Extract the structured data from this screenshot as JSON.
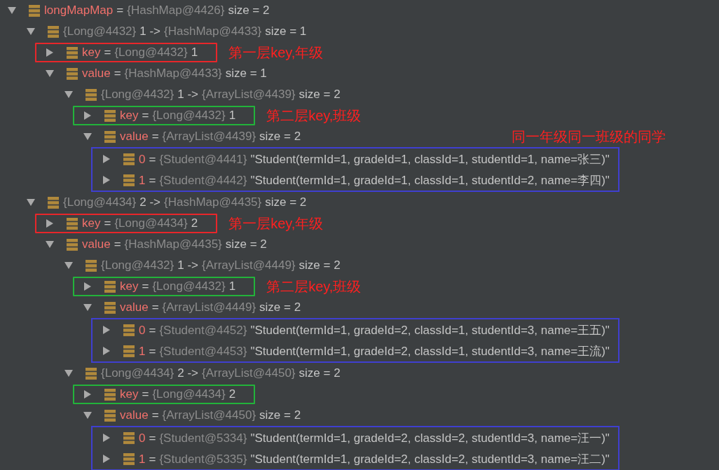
{
  "tree": {
    "expanded": true,
    "segments": [
      {
        "kind": "name",
        "text": "longMapMap"
      },
      {
        "kind": "plain",
        "text": "="
      },
      {
        "kind": "ref",
        "text": "{HashMap@4426}"
      },
      {
        "kind": "plain",
        "text": "size = 2"
      }
    ],
    "children": [
      {
        "expanded": true,
        "segments": [
          {
            "kind": "ref",
            "text": "{Long@4432}"
          },
          {
            "kind": "plain",
            "text": "1 ->"
          },
          {
            "kind": "ref",
            "text": "{HashMap@4433}"
          },
          {
            "kind": "plain",
            "text": "size = 1"
          }
        ],
        "children": [
          {
            "expanded": false,
            "frame": {
              "color": "#e8262a",
              "note": "第一层key,年级"
            },
            "segments": [
              {
                "kind": "name",
                "text": "key"
              },
              {
                "kind": "plain",
                "text": "="
              },
              {
                "kind": "ref",
                "text": "{Long@4432}"
              },
              {
                "kind": "plain",
                "text": "1"
              }
            ]
          },
          {
            "expanded": true,
            "segments": [
              {
                "kind": "name",
                "text": "value"
              },
              {
                "kind": "plain",
                "text": "="
              },
              {
                "kind": "ref",
                "text": "{HashMap@4433}"
              },
              {
                "kind": "plain",
                "text": "size = 1"
              }
            ],
            "children": [
              {
                "expanded": true,
                "segments": [
                  {
                    "kind": "ref",
                    "text": "{Long@4432}"
                  },
                  {
                    "kind": "plain",
                    "text": "1 ->"
                  },
                  {
                    "kind": "ref",
                    "text": "{ArrayList@4439}"
                  },
                  {
                    "kind": "plain",
                    "text": "size = 2"
                  }
                ],
                "children": [
                  {
                    "expanded": false,
                    "frame": {
                      "color": "#22b33a",
                      "note": "第二层key,班级"
                    },
                    "segments": [
                      {
                        "kind": "name",
                        "text": "key"
                      },
                      {
                        "kind": "plain",
                        "text": "="
                      },
                      {
                        "kind": "ref",
                        "text": "{Long@4432}"
                      },
                      {
                        "kind": "plain",
                        "text": "1"
                      }
                    ]
                  },
                  {
                    "expanded": true,
                    "children_frame": {
                      "color": "#3f3fd0",
                      "note": "同一年级同一班级的同学"
                    },
                    "segments": [
                      {
                        "kind": "name",
                        "text": "value"
                      },
                      {
                        "kind": "plain",
                        "text": "="
                      },
                      {
                        "kind": "ref",
                        "text": "{ArrayList@4439}"
                      },
                      {
                        "kind": "plain",
                        "text": "size = 2"
                      }
                    ],
                    "children": [
                      {
                        "expanded": false,
                        "segments": [
                          {
                            "kind": "name",
                            "text": "0"
                          },
                          {
                            "kind": "plain",
                            "text": "="
                          },
                          {
                            "kind": "ref",
                            "text": "{Student@4441}"
                          },
                          {
                            "kind": "plain",
                            "text": "\"Student(termId=1, gradeId=1, classId=1, studentId=1, name=张三)\""
                          }
                        ]
                      },
                      {
                        "expanded": false,
                        "segments": [
                          {
                            "kind": "name",
                            "text": "1"
                          },
                          {
                            "kind": "plain",
                            "text": "="
                          },
                          {
                            "kind": "ref",
                            "text": "{Student@4442}"
                          },
                          {
                            "kind": "plain",
                            "text": "\"Student(termId=1, gradeId=1, classId=1, studentId=2, name=李四)\""
                          }
                        ]
                      }
                    ]
                  }
                ]
              }
            ]
          }
        ]
      },
      {
        "expanded": true,
        "segments": [
          {
            "kind": "ref",
            "text": "{Long@4434}"
          },
          {
            "kind": "plain",
            "text": "2 ->"
          },
          {
            "kind": "ref",
            "text": "{HashMap@4435}"
          },
          {
            "kind": "plain",
            "text": "size = 2"
          }
        ],
        "children": [
          {
            "expanded": false,
            "frame": {
              "color": "#e8262a",
              "note": "第一层key,年级"
            },
            "segments": [
              {
                "kind": "name",
                "text": "key"
              },
              {
                "kind": "plain",
                "text": "="
              },
              {
                "kind": "ref",
                "text": "{Long@4434}"
              },
              {
                "kind": "plain",
                "text": "2"
              }
            ]
          },
          {
            "expanded": true,
            "segments": [
              {
                "kind": "name",
                "text": "value"
              },
              {
                "kind": "plain",
                "text": "="
              },
              {
                "kind": "ref",
                "text": "{HashMap@4435}"
              },
              {
                "kind": "plain",
                "text": "size = 2"
              }
            ],
            "children": [
              {
                "expanded": true,
                "segments": [
                  {
                    "kind": "ref",
                    "text": "{Long@4432}"
                  },
                  {
                    "kind": "plain",
                    "text": "1 ->"
                  },
                  {
                    "kind": "ref",
                    "text": "{ArrayList@4449}"
                  },
                  {
                    "kind": "plain",
                    "text": "size = 2"
                  }
                ],
                "children": [
                  {
                    "expanded": false,
                    "frame": {
                      "color": "#22b33a",
                      "note": "第二层key,班级"
                    },
                    "segments": [
                      {
                        "kind": "name",
                        "text": "key"
                      },
                      {
                        "kind": "plain",
                        "text": "="
                      },
                      {
                        "kind": "ref",
                        "text": "{Long@4432}"
                      },
                      {
                        "kind": "plain",
                        "text": "1"
                      }
                    ]
                  },
                  {
                    "expanded": true,
                    "children_frame": {
                      "color": "#3f3fd0"
                    },
                    "segments": [
                      {
                        "kind": "name",
                        "text": "value"
                      },
                      {
                        "kind": "plain",
                        "text": "="
                      },
                      {
                        "kind": "ref",
                        "text": "{ArrayList@4449}"
                      },
                      {
                        "kind": "plain",
                        "text": "size = 2"
                      }
                    ],
                    "children": [
                      {
                        "expanded": false,
                        "segments": [
                          {
                            "kind": "name",
                            "text": "0"
                          },
                          {
                            "kind": "plain",
                            "text": "="
                          },
                          {
                            "kind": "ref",
                            "text": "{Student@4452}"
                          },
                          {
                            "kind": "plain",
                            "text": "\"Student(termId=1, gradeId=2, classId=1, studentId=3, name=王五)\""
                          }
                        ]
                      },
                      {
                        "expanded": false,
                        "segments": [
                          {
                            "kind": "name",
                            "text": "1"
                          },
                          {
                            "kind": "plain",
                            "text": "="
                          },
                          {
                            "kind": "ref",
                            "text": "{Student@4453}"
                          },
                          {
                            "kind": "plain",
                            "text": "\"Student(termId=1, gradeId=2, classId=1, studentId=3, name=王流)\""
                          }
                        ]
                      }
                    ]
                  }
                ]
              },
              {
                "expanded": true,
                "segments": [
                  {
                    "kind": "ref",
                    "text": "{Long@4434}"
                  },
                  {
                    "kind": "plain",
                    "text": "2 ->"
                  },
                  {
                    "kind": "ref",
                    "text": "{ArrayList@4450}"
                  },
                  {
                    "kind": "plain",
                    "text": "size = 2"
                  }
                ],
                "children": [
                  {
                    "expanded": false,
                    "frame": {
                      "color": "#22b33a"
                    },
                    "segments": [
                      {
                        "kind": "name",
                        "text": "key"
                      },
                      {
                        "kind": "plain",
                        "text": "="
                      },
                      {
                        "kind": "ref",
                        "text": "{Long@4434}"
                      },
                      {
                        "kind": "plain",
                        "text": "2"
                      }
                    ]
                  },
                  {
                    "expanded": true,
                    "children_frame": {
                      "color": "#3f3fd0"
                    },
                    "segments": [
                      {
                        "kind": "name",
                        "text": "value"
                      },
                      {
                        "kind": "plain",
                        "text": "="
                      },
                      {
                        "kind": "ref",
                        "text": "{ArrayList@4450}"
                      },
                      {
                        "kind": "plain",
                        "text": "size = 2"
                      }
                    ],
                    "children": [
                      {
                        "expanded": false,
                        "segments": [
                          {
                            "kind": "name",
                            "text": "0"
                          },
                          {
                            "kind": "plain",
                            "text": "="
                          },
                          {
                            "kind": "ref",
                            "text": "{Student@5334}"
                          },
                          {
                            "kind": "plain",
                            "text": "\"Student(termId=1, gradeId=2, classId=2, studentId=3, name=汪一)\""
                          }
                        ]
                      },
                      {
                        "expanded": false,
                        "segments": [
                          {
                            "kind": "name",
                            "text": "1"
                          },
                          {
                            "kind": "plain",
                            "text": "="
                          },
                          {
                            "kind": "ref",
                            "text": "{Student@5335}"
                          },
                          {
                            "kind": "plain",
                            "text": "\"Student(termId=1, gradeId=2, classId=2, studentId=3, name=汪二)\""
                          }
                        ]
                      }
                    ]
                  }
                ]
              }
            ]
          }
        ]
      }
    ]
  }
}
